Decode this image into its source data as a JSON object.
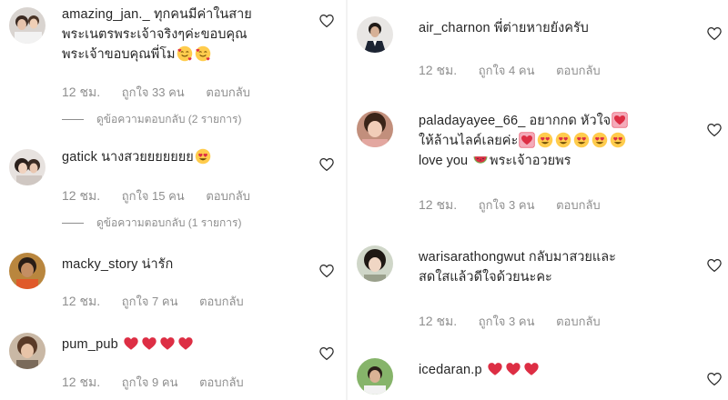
{
  "left_comments": [
    {
      "username": "amazing_jan._",
      "text": "ทุกคนมีค่าในสายพระเนตรพระเจ้าจริงๆค่ะขอบคุณพระเจ้าขอบคุณพี่โม",
      "text_lines": [
        "ทุกคนมีค่าในสาย",
        "พระเนตรพระเจ้าจริงๆค่ะขอบคุณ",
        "พระเจ้าขอบคุณพี่โม"
      ],
      "emojis": [
        "smiling-hearts-emoji",
        "smiling-hearts-emoji"
      ],
      "time": "12 ชม.",
      "likes": "ถูกใจ 33 คน",
      "reply_label": "ตอบกลับ",
      "view_replies": "ดูข้อความตอบกลับ (2 รายการ)"
    },
    {
      "username": "gatick",
      "text": "นางสวยยยยยยย",
      "emojis": [
        "heart-eyes-emoji"
      ],
      "time": "12 ชม.",
      "likes": "ถูกใจ 15 คน",
      "reply_label": "ตอบกลับ",
      "view_replies": "ดูข้อความตอบกลับ (1 รายการ)"
    },
    {
      "username": "macky_story",
      "text": "น่ารัก",
      "time": "12 ชม.",
      "likes": "ถูกใจ 7 คน",
      "reply_label": "ตอบกลับ"
    },
    {
      "username": "pum_pub",
      "text": "",
      "emojis": [
        "red-heart-emoji",
        "red-heart-emoji",
        "red-heart-emoji",
        "red-heart-emoji"
      ],
      "time": "12 ชม.",
      "likes": "ถูกใจ 9 คน",
      "reply_label": "ตอบกลับ"
    }
  ],
  "right_comments": [
    {
      "username": "air_charnon",
      "text": "พี่ต่ายหายยังครับ",
      "time": "12 ชม.",
      "likes": "ถูกใจ 4 คน",
      "reply_label": "ตอบกลับ"
    },
    {
      "username": "paladayayee_66_",
      "text_lines": [
        "อยากกด หัวใจ",
        "ให้ล้านไลค์เลยค่ะ",
        "love you",
        "พระเจ้าอวยพร"
      ],
      "emojis": [
        "heart-box-emoji",
        "heart-box-emoji",
        "heart-eyes-emoji",
        "watermelon-emoji"
      ],
      "time": "12 ชม.",
      "likes": "ถูกใจ 3 คน",
      "reply_label": "ตอบกลับ"
    },
    {
      "username": "warisarathongwut",
      "text_lines": [
        "กลับมาสวยและ",
        "สดใสแล้วดีใจด้วยนะคะ"
      ],
      "time": "12 ชม.",
      "likes": "ถูกใจ 3 คน",
      "reply_label": "ตอบกลับ"
    },
    {
      "username": "icedaran.p",
      "text": "",
      "emojis": [
        "red-heart-emoji",
        "red-heart-emoji",
        "red-heart-emoji"
      ]
    }
  ],
  "colors": {
    "text": "#262626",
    "secondary": "#8e8e8e",
    "heart_emoji": "#e0245e"
  },
  "icons": [
    "like-heart-outline-icon"
  ]
}
